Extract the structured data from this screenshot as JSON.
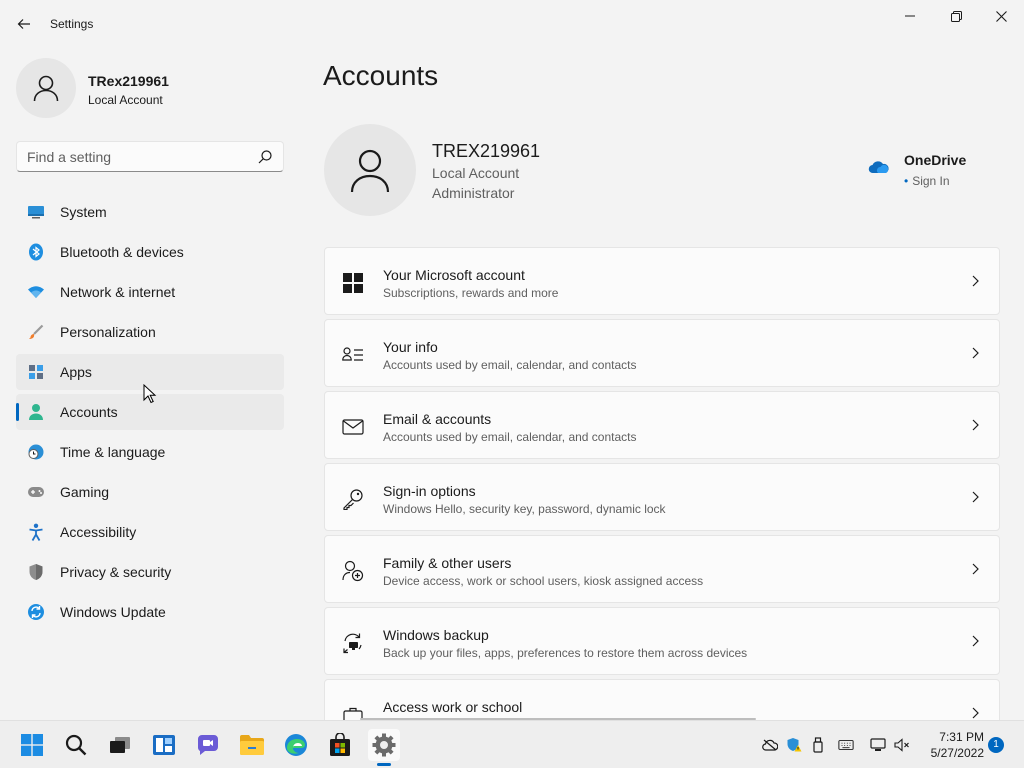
{
  "window": {
    "title": "Settings"
  },
  "profile": {
    "name": "TRex219961",
    "account_type": "Local Account"
  },
  "search": {
    "placeholder": "Find a setting"
  },
  "nav": {
    "items": [
      {
        "label": "System",
        "icon": "monitor-icon"
      },
      {
        "label": "Bluetooth & devices",
        "icon": "bluetooth-icon"
      },
      {
        "label": "Network & internet",
        "icon": "wifi-icon"
      },
      {
        "label": "Personalization",
        "icon": "brush-icon"
      },
      {
        "label": "Apps",
        "icon": "apps-icon"
      },
      {
        "label": "Accounts",
        "icon": "person-icon"
      },
      {
        "label": "Time & language",
        "icon": "globe-clock-icon"
      },
      {
        "label": "Gaming",
        "icon": "gamepad-icon"
      },
      {
        "label": "Accessibility",
        "icon": "accessibility-icon"
      },
      {
        "label": "Privacy & security",
        "icon": "shield-icon"
      },
      {
        "label": "Windows Update",
        "icon": "update-icon"
      }
    ],
    "selected": "Accounts",
    "hovered": "Apps"
  },
  "main": {
    "title": "Accounts",
    "account": {
      "name": "TREX219961",
      "type": "Local Account",
      "role": "Administrator"
    },
    "onedrive": {
      "title": "OneDrive",
      "status": "Sign In"
    },
    "cards": [
      {
        "title": "Your Microsoft account",
        "subtitle": "Subscriptions, rewards and more",
        "icon": "windows-logo-icon"
      },
      {
        "title": "Your info",
        "subtitle": "Accounts used by email, calendar, and contacts",
        "icon": "contact-card-icon"
      },
      {
        "title": "Email & accounts",
        "subtitle": "Accounts used by email, calendar, and contacts",
        "icon": "mail-icon"
      },
      {
        "title": "Sign-in options",
        "subtitle": "Windows Hello, security key, password, dynamic lock",
        "icon": "key-icon"
      },
      {
        "title": "Family & other users",
        "subtitle": "Device access, work or school users, kiosk assigned access",
        "icon": "add-person-icon"
      },
      {
        "title": "Windows backup",
        "subtitle": "Back up your files, apps, preferences to restore them across devices",
        "icon": "backup-icon"
      },
      {
        "title": "Access work or school",
        "subtitle": "",
        "icon": "briefcase-icon"
      }
    ]
  },
  "taskbar": {
    "apps": [
      "start-icon",
      "search-icon",
      "task-view-icon",
      "widgets-icon",
      "chat-icon",
      "file-explorer-icon",
      "edge-icon",
      "store-icon",
      "settings-icon"
    ],
    "time": "7:31 PM",
    "date": "5/27/2022",
    "notifications": "1"
  },
  "colors": {
    "accent": "#0067c0",
    "background": "#f3f3f3",
    "card": "#fbfbfb"
  }
}
